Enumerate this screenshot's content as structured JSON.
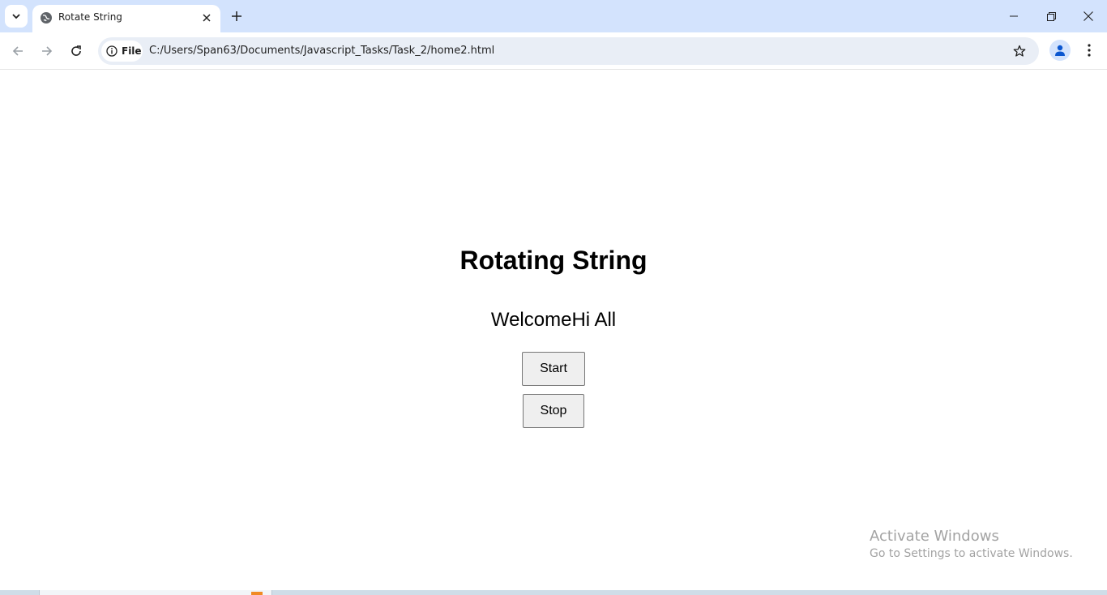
{
  "browser": {
    "tab": {
      "title": "Rotate String"
    },
    "omnibox": {
      "chip_label": "File",
      "url": "C:/Users/Span63/Documents/Javascript_Tasks/Task_2/home2.html"
    },
    "icons": {
      "tab_search": "chevron-down-icon",
      "favicon": "globe-icon",
      "tab_close": "close-icon",
      "new_tab": "plus-icon",
      "minimize": "minimize-icon",
      "restore": "restore-icon",
      "close_window": "close-icon",
      "back": "arrow-left-icon",
      "forward": "arrow-right-icon",
      "reload": "reload-icon",
      "site_info": "info-icon",
      "bookmark": "star-icon",
      "profile": "person-icon",
      "menu": "kebab-menu-icon"
    }
  },
  "page": {
    "heading": "Rotating String",
    "rotating_text": "WelcomeHi All",
    "start_label": "Start",
    "stop_label": "Stop"
  },
  "watermark": {
    "title": "Activate Windows",
    "subtitle": "Go to Settings to activate Windows."
  },
  "colors": {
    "titlebar_bg": "#d3e3fd",
    "omnibox_bg": "#e9eef6",
    "button_bg": "#efefef"
  }
}
